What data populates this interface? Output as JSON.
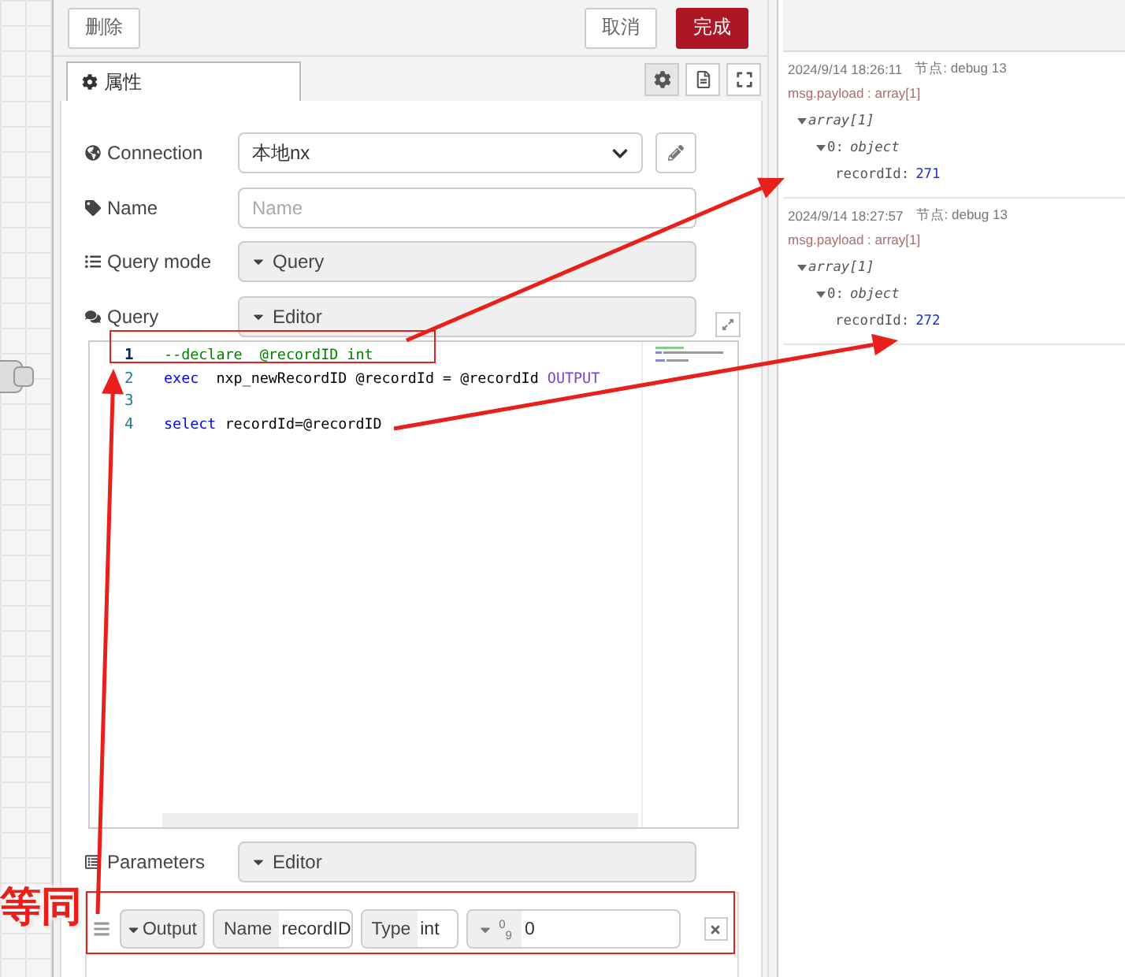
{
  "toolbar": {
    "delete": "删除",
    "cancel": "取消",
    "done": "完成"
  },
  "tabs": [
    {
      "label": "属性",
      "selected": true
    }
  ],
  "fields": [
    {
      "kind": "select",
      "label": "Connection",
      "value": "本地nx"
    },
    {
      "kind": "text",
      "label": "Name",
      "placeholder": "Name"
    },
    {
      "kind": "typed",
      "label": "Query mode",
      "value": "Query"
    },
    {
      "kind": "typed",
      "label": "Query",
      "value": "Editor"
    }
  ],
  "code_lines": [
    {
      "number": "1",
      "active": true,
      "tokens": [
        {
          "kind": "comment",
          "text": "--declare  @recordID int"
        }
      ]
    },
    {
      "number": "2",
      "active": false,
      "tokens": [
        {
          "kind": "keyword",
          "text": "exec"
        },
        {
          "kind": "plain",
          "text": "  nxp_newRecordID @recordId = @recordId "
        },
        {
          "kind": "builtin",
          "text": "OUTPUT"
        }
      ]
    },
    {
      "number": "3",
      "active": false
    },
    {
      "number": "4",
      "active": false,
      "tokens": [
        {
          "kind": "keyword",
          "text": "select"
        },
        {
          "kind": "plain",
          "text": " recordId=@recordID"
        }
      ]
    }
  ],
  "parameters": {
    "label": "Parameters",
    "value": "Editor",
    "rows": [
      {
        "direction": "Output",
        "name_label": "Name",
        "name": "recordID",
        "type_label": "Type",
        "type": "int",
        "value_type": "$^{0}$$_{9}$",
        "value": "0"
      }
    ]
  },
  "debug_messages": [
    {
      "time": "2024/9/14 18:26:11",
      "node": "节点: debug 13",
      "topic": "msg.payload : array[1]",
      "tree": {
        "type": "array[1]",
        "expanded": true,
        "children": [
          {
            "key": "0:",
            "type": "object",
            "expanded": true,
            "children": [
              {
                "key": "recordId:",
                "value": "271"
              }
            ]
          }
        ]
      }
    },
    {
      "time": "2024/9/14 18:27:57",
      "node": "节点: debug 13",
      "topic": "msg.payload : array[1]",
      "tree": {
        "type": "array[1]",
        "expanded": true,
        "children": [
          {
            "key": "0:",
            "type": "object",
            "expanded": true,
            "children": [
              {
                "key": "recordId:",
                "value": "272"
              }
            ]
          }
        ]
      }
    }
  ],
  "annotation": {
    "label": "等同"
  }
}
